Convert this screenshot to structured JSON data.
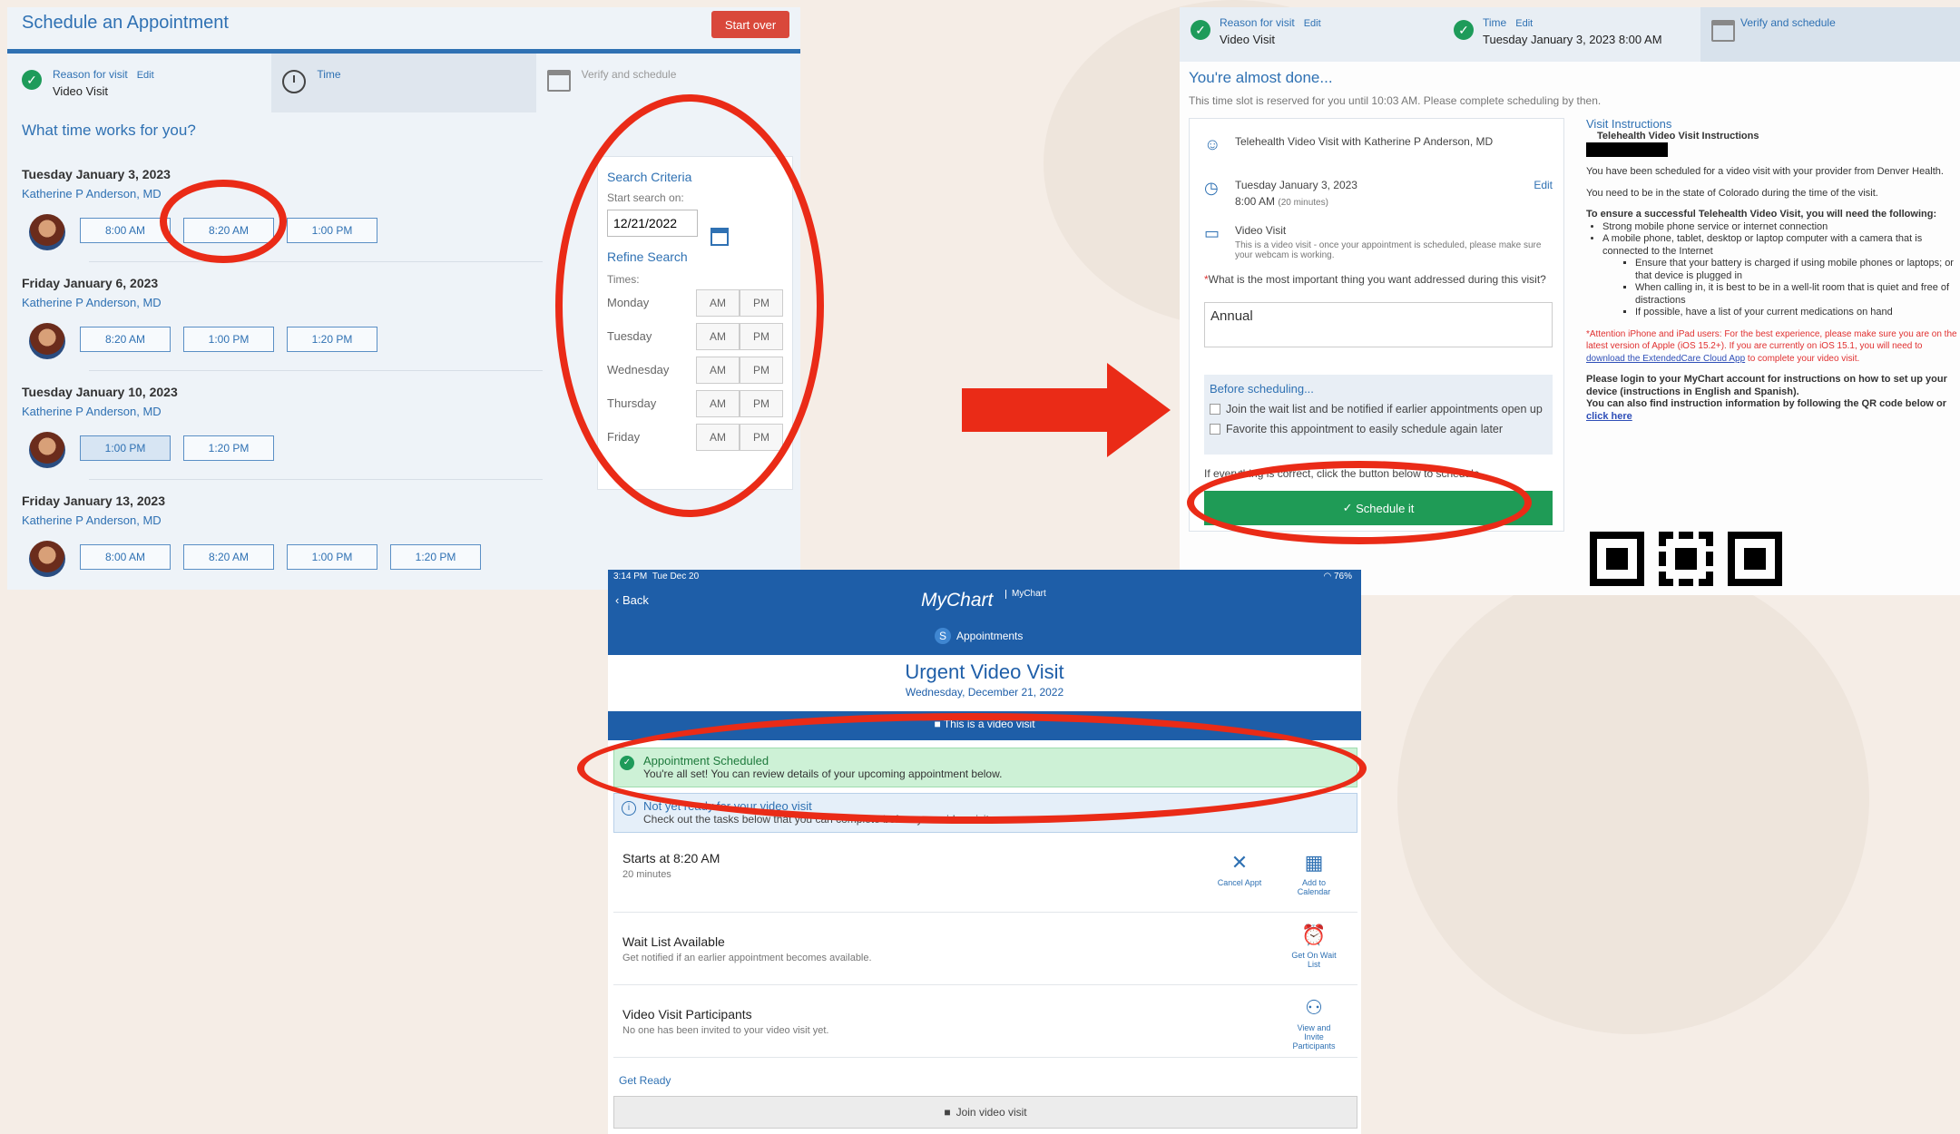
{
  "panel1": {
    "title": "Schedule an Appointment",
    "start_over": "Start over",
    "steps": [
      {
        "label": "Reason for visit",
        "edit": "Edit",
        "value": "Video Visit"
      },
      {
        "label": "Time"
      },
      {
        "label": "Verify and schedule"
      }
    ],
    "question": "What time works for you?",
    "days": [
      {
        "date": "Tuesday January 3, 2023",
        "provider": "Katherine P Anderson, MD",
        "slots": [
          "8:00 AM",
          "8:20 AM",
          "1:00 PM"
        ]
      },
      {
        "date": "Friday January 6, 2023",
        "provider": "Katherine P Anderson, MD",
        "slots": [
          "8:20 AM",
          "1:00 PM",
          "1:20 PM"
        ]
      },
      {
        "date": "Tuesday January 10, 2023",
        "provider": "Katherine P Anderson, MD",
        "slots": [
          "1:00 PM",
          "1:20 PM"
        ]
      },
      {
        "date": "Friday January 13, 2023",
        "provider": "Katherine P Anderson, MD",
        "slots": [
          "8:00 AM",
          "8:20 AM",
          "1:00 PM",
          "1:20 PM"
        ]
      }
    ],
    "criteria": {
      "heading": "Search Criteria",
      "start_label": "Start search on:",
      "start_date": "12/21/2022",
      "refine": "Refine Search",
      "times_label": "Times:",
      "days": [
        "Monday",
        "Tuesday",
        "Wednesday",
        "Thursday",
        "Friday"
      ],
      "am": "AM",
      "pm": "PM"
    }
  },
  "panel2": {
    "steps": [
      {
        "label": "Reason for visit",
        "edit": "Edit",
        "value": "Video Visit"
      },
      {
        "label": "Time",
        "edit": "Edit",
        "value": "Tuesday January 3, 2023 8:00 AM"
      },
      {
        "label": "Verify and schedule"
      }
    ],
    "almost_done": "You're almost done...",
    "reserved": "This time slot is reserved for you until 10:03 AM. Please complete scheduling by then.",
    "visit_with": "Telehealth Video Visit with Katherine P Anderson, MD",
    "date": "Tuesday January 3, 2023",
    "time": "8:00 AM",
    "duration": "(20 minutes)",
    "edit": "Edit",
    "visit_type": "Video Visit",
    "visit_note": "This is a video visit - once your appointment is scheduled, please make sure your webcam is working.",
    "question": "What is the most important thing you want addressed during this visit?",
    "answer": "Annual",
    "before_heading": "Before scheduling...",
    "waitlist": "Join the wait list and be notified if earlier appointments open up",
    "favorite": "Favorite this appointment to easily schedule again later",
    "if_correct": "If everything is correct, click the button below to schedule.",
    "schedule_btn": "Schedule it",
    "instructions": {
      "heading": "Visit Instructions",
      "subheading": "Telehealth Video Visit Instructions",
      "p1": "You have been scheduled for a video visit with your provider from Denver Health.",
      "p2": "You need to be in the state of Colorado during the time of the visit.",
      "p3": "To ensure a successful Telehealth Video Visit, you will need the following:",
      "b1": "Strong mobile phone service or internet connection",
      "b2": "A mobile phone, tablet, desktop or laptop computer with a camera that is connected to the Internet",
      "b3": "Ensure that your battery is charged if using mobile phones or laptops; or that device is plugged in",
      "b4": "When calling in, it is best to be in a well-lit room that is quiet and free of distractions",
      "b5": "If possible, have a list of your current medications on hand",
      "attn": "*Attention iPhone and iPad users: For the best experience, please make sure you are on the latest version of Apple (iOS 15.2+). If you are currently on iOS 15.1, you will need to",
      "attn_link": "download the ExtendedCare Cloud App",
      "attn_end": "to complete your video visit.",
      "p4": "Please login to your MyChart account for instructions on how to set up your device (instructions in English and Spanish).",
      "p5": "You can also find instruction information by following the QR code below or",
      "p5_link": "click here"
    }
  },
  "panel3": {
    "time": "3:14 PM",
    "date": "Tue Dec 20",
    "battery": "76%",
    "back": "Back",
    "logo": "MyChart",
    "logo2": "MyChart",
    "tab": "Appointments",
    "tab_icon": "S",
    "title": "Urgent Video Visit",
    "subtitle": "Wednesday, December 21, 2022",
    "banner": "This is a video visit",
    "sched_heading": "Appointment Scheduled",
    "sched_text": "You're all set! You can review details of your upcoming appointment below.",
    "info_heading": "Not yet ready for your video visit",
    "info_text": "Check out the tasks below that you can complete before your video visit.",
    "starts": "Starts at 8:20 AM",
    "duration": "20 minutes",
    "cancel": "Cancel Appt",
    "add_cal": "Add to Calendar",
    "wait_h": "Wait List Available",
    "wait_s": "Get notified if an earlier appointment becomes available.",
    "wait_btn": "Get On Wait List",
    "part_h": "Video Visit Participants",
    "part_s": "No one has been invited to your video visit yet.",
    "part_btn": "View and Invite Participants",
    "get_ready": "Get Ready",
    "join": "Join video visit"
  },
  "colors": {
    "accent": "#2f71b3",
    "ring": "#ea2b17",
    "green": "#1f9b56",
    "mychart_blue": "#1e5ea8"
  }
}
